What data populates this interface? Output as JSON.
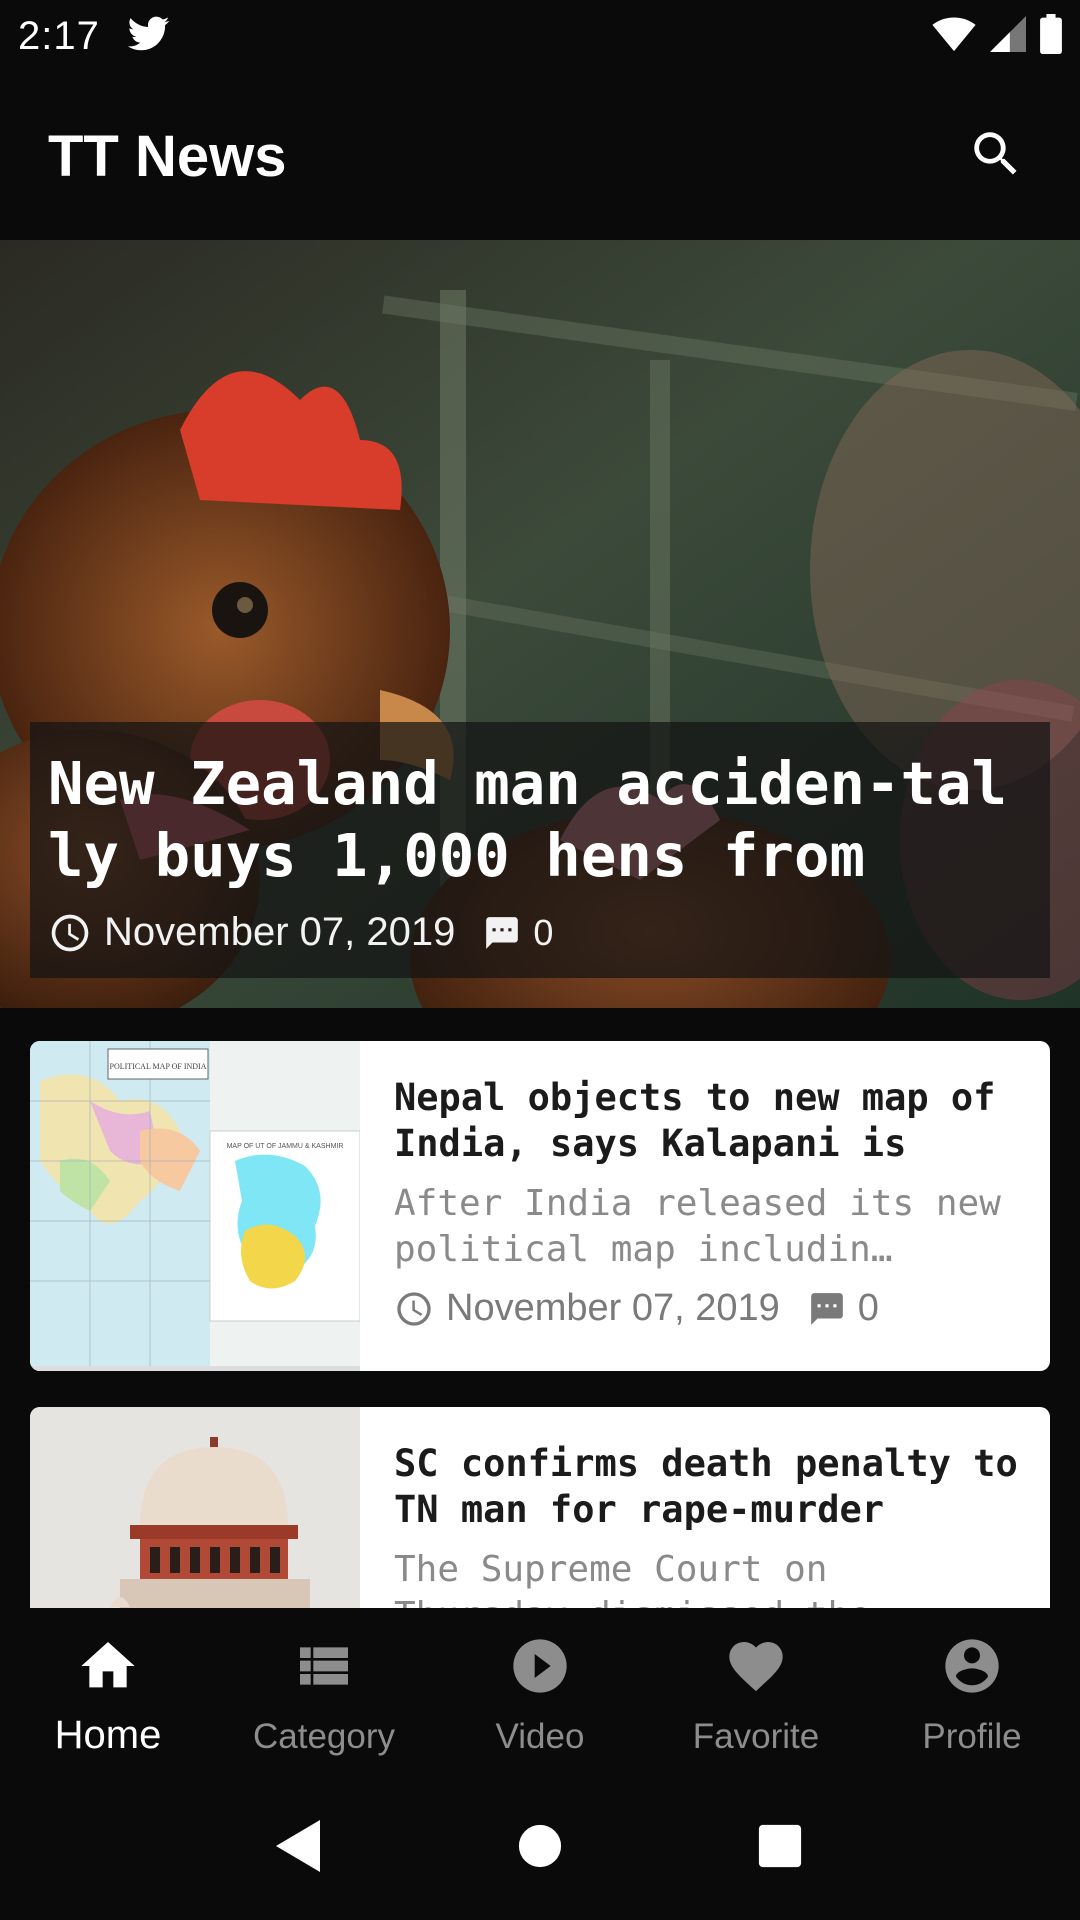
{
  "status_bar": {
    "time": "2:17",
    "icons": [
      "twitter-icon",
      "wifi-icon",
      "signal-icon",
      "battery-icon"
    ]
  },
  "app_bar": {
    "title": "TT News",
    "search_icon": "search-icon"
  },
  "featured": {
    "title": "New Zealand man acciden-tally buys 1,000 hens from",
    "date": "November 07, 2019",
    "comments": "0"
  },
  "articles": [
    {
      "title": "Nepal objects to new map of India, says Kalapani is",
      "description": "After India released its new political map includin…",
      "date": "November 07, 2019",
      "comments": "0",
      "thumb_labels": [
        "POLITICAL MAP OF INDIA",
        "MAP OF UT OF JAMMU & KASHMIR"
      ]
    },
    {
      "title": "SC confirms death penalty to TN man for rape-murder",
      "description": "The Supreme Court on Thursday dismissed the",
      "date": "",
      "comments": ""
    }
  ],
  "bottom_nav": [
    {
      "label": "Home",
      "icon": "home-icon",
      "active": true
    },
    {
      "label": "Category",
      "icon": "list-icon",
      "active": false
    },
    {
      "label": "Video",
      "icon": "play-circle-icon",
      "active": false
    },
    {
      "label": "Favorite",
      "icon": "heart-icon",
      "active": false
    },
    {
      "label": "Profile",
      "icon": "account-circle-icon",
      "active": false
    }
  ],
  "system_nav": [
    "back-icon",
    "home-circle-icon",
    "recents-icon"
  ],
  "colors": {
    "background": "#0a0a0a",
    "card": "#ffffff",
    "nav_active": "#ffffff",
    "nav_inactive": "#8d8d8d",
    "meta_text": "#7a7a7a"
  }
}
